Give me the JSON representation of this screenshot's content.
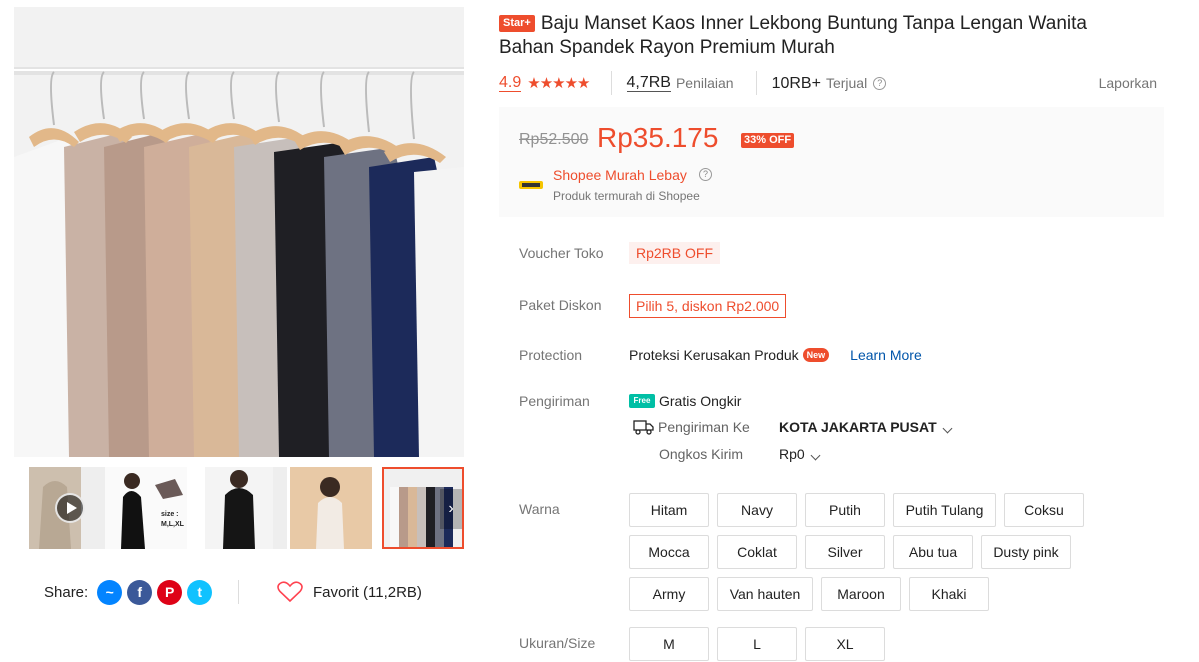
{
  "gallery": {
    "thumb_size_text": "size :",
    "thumb_size_values": "M,L,XL"
  },
  "share": {
    "label": "Share:"
  },
  "favorite": {
    "label": "Favorit (11,2RB)"
  },
  "product": {
    "badge": "Star+",
    "title": "Baju Manset Kaos Inner Lekbong Buntung Tanpa Lengan Wanita Bahan Spandek Rayon Premium Murah"
  },
  "stats": {
    "rating": "4.9",
    "stars": "★★★★★",
    "reviews_count": "4,7RB",
    "reviews_label": "Penilaian",
    "sold_count": "10RB+",
    "sold_label": "Terjual",
    "report": "Laporkan"
  },
  "price": {
    "original": "Rp52.500",
    "current": "Rp35.175",
    "discount": "33% OFF",
    "shop_name": "Shopee Murah Lebay",
    "shop_sub": "Produk termurah di Shopee"
  },
  "voucher": {
    "label": "Voucher Toko",
    "value": "Rp2RB OFF"
  },
  "paket": {
    "label": "Paket Diskon",
    "value": "Pilih 5, diskon Rp2.000"
  },
  "protection": {
    "label": "Protection",
    "value": "Proteksi Kerusakan Produk",
    "badge": "New",
    "link": "Learn More"
  },
  "shipping": {
    "label": "Pengiriman",
    "free_badge": "Free",
    "free_text": "Gratis Ongkir",
    "to_label": "Pengiriman Ke",
    "to_value": "KOTA JAKARTA PUSAT",
    "cost_label": "Ongkos Kirim",
    "cost_value": "Rp0"
  },
  "colors": {
    "label": "Warna",
    "options": [
      "Hitam",
      "Navy",
      "Putih",
      "Putih Tulang",
      "Coksu",
      "Mocca",
      "Coklat",
      "Silver",
      "Abu tua",
      "Dusty pink",
      "Army",
      "Van hauten",
      "Maroon",
      "Khaki"
    ]
  },
  "sizes": {
    "label": "Ukuran/Size",
    "options": [
      "M",
      "L",
      "XL"
    ]
  },
  "theme": {
    "accent": "#ee4d2d",
    "link": "#0055aa",
    "free": "#00bfa5"
  }
}
